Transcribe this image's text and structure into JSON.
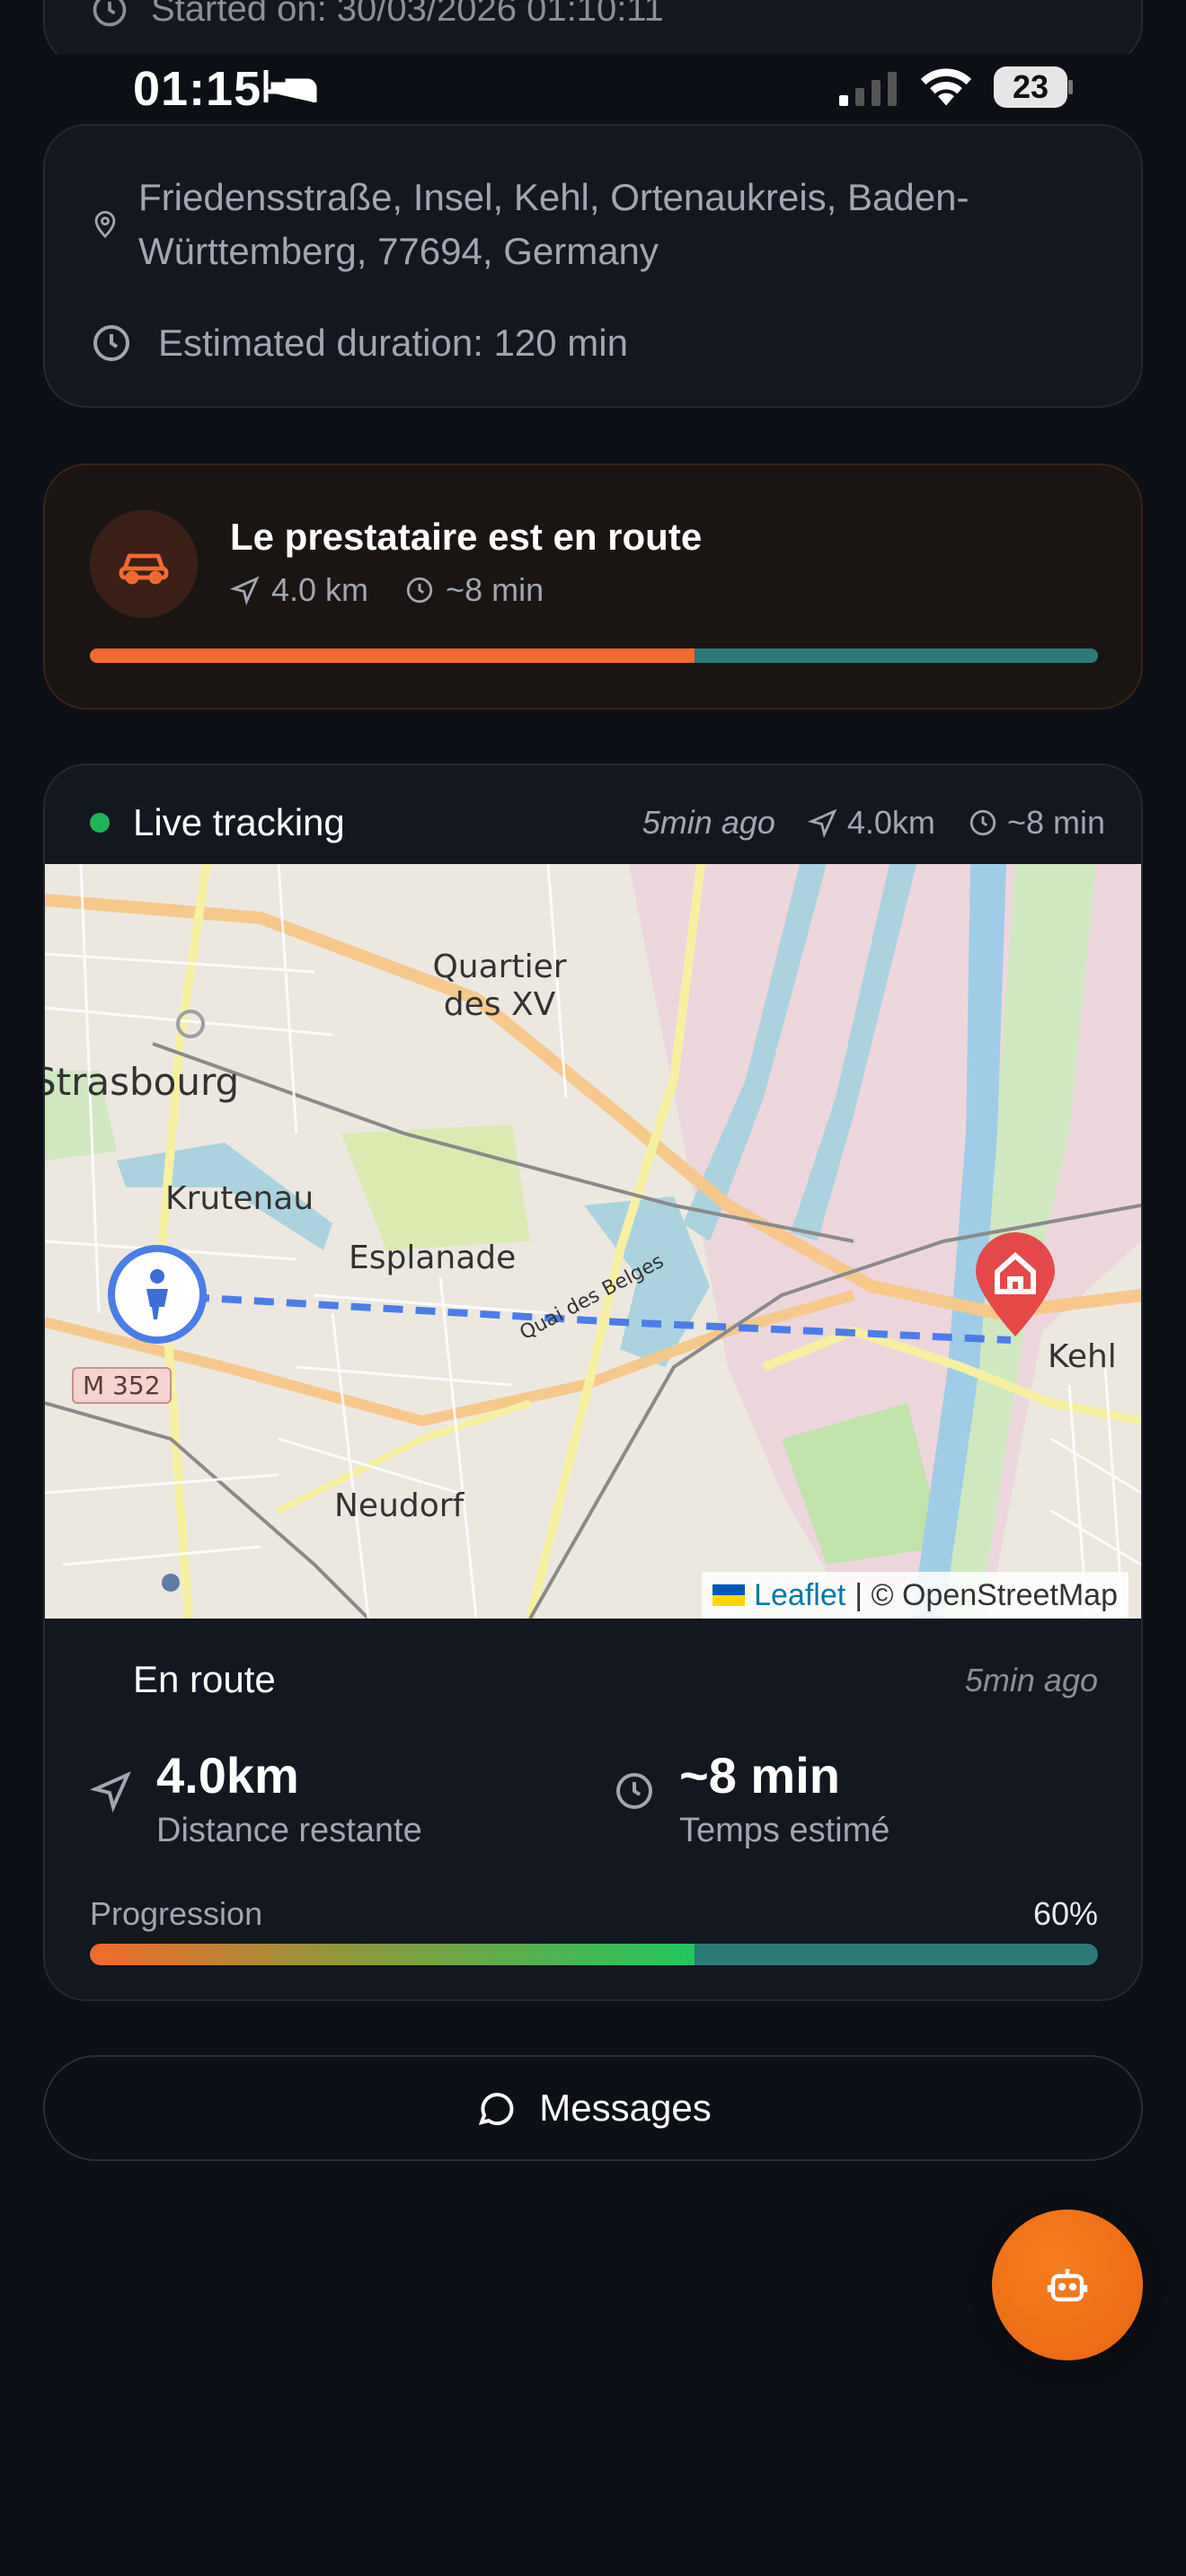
{
  "top_partial": {
    "text": "Started on: 30/03/2026 01:10:11"
  },
  "status_bar": {
    "time": "01:15",
    "battery": "23"
  },
  "address_card": {
    "address": "Friedensstraße, Insel, Kehl, Ortenaukreis, Baden-Württemberg, 77694, Germany",
    "duration": "Estimated duration: 120 min"
  },
  "route_card": {
    "title": "Le prestataire est en route",
    "distance": "4.0 km",
    "eta": "~8 min",
    "progress": 0.6,
    "colors": {
      "accent": "#f26a2e",
      "track": "#2b7a78"
    }
  },
  "tracking": {
    "title": "Live tracking",
    "updated": "5min ago",
    "distance": "4.0km",
    "eta": "~8 min",
    "map": {
      "labels": {
        "quartier": "Quartier des XV",
        "strasbourg": "Strasbourg",
        "krutenau": "Krutenau",
        "esplanade": "Esplanade",
        "neudorf": "Neudorf",
        "kehl": "Kehl",
        "m352": "M 352",
        "quai": "Quai des Belges"
      },
      "attribution": {
        "leaflet": "Leaflet",
        "osm": "| © OpenStreetMap"
      }
    },
    "status": "En route",
    "status_updated": "5min ago",
    "distance_value": "4.0km",
    "distance_label": "Distance restante",
    "time_value": "~8 min",
    "time_label": "Temps estimé",
    "progress_label": "Progression",
    "progress_pct": "60%",
    "progress": 0.6
  },
  "messages_button": {
    "label": "Messages"
  },
  "fab": {
    "icon": "bot-icon"
  }
}
